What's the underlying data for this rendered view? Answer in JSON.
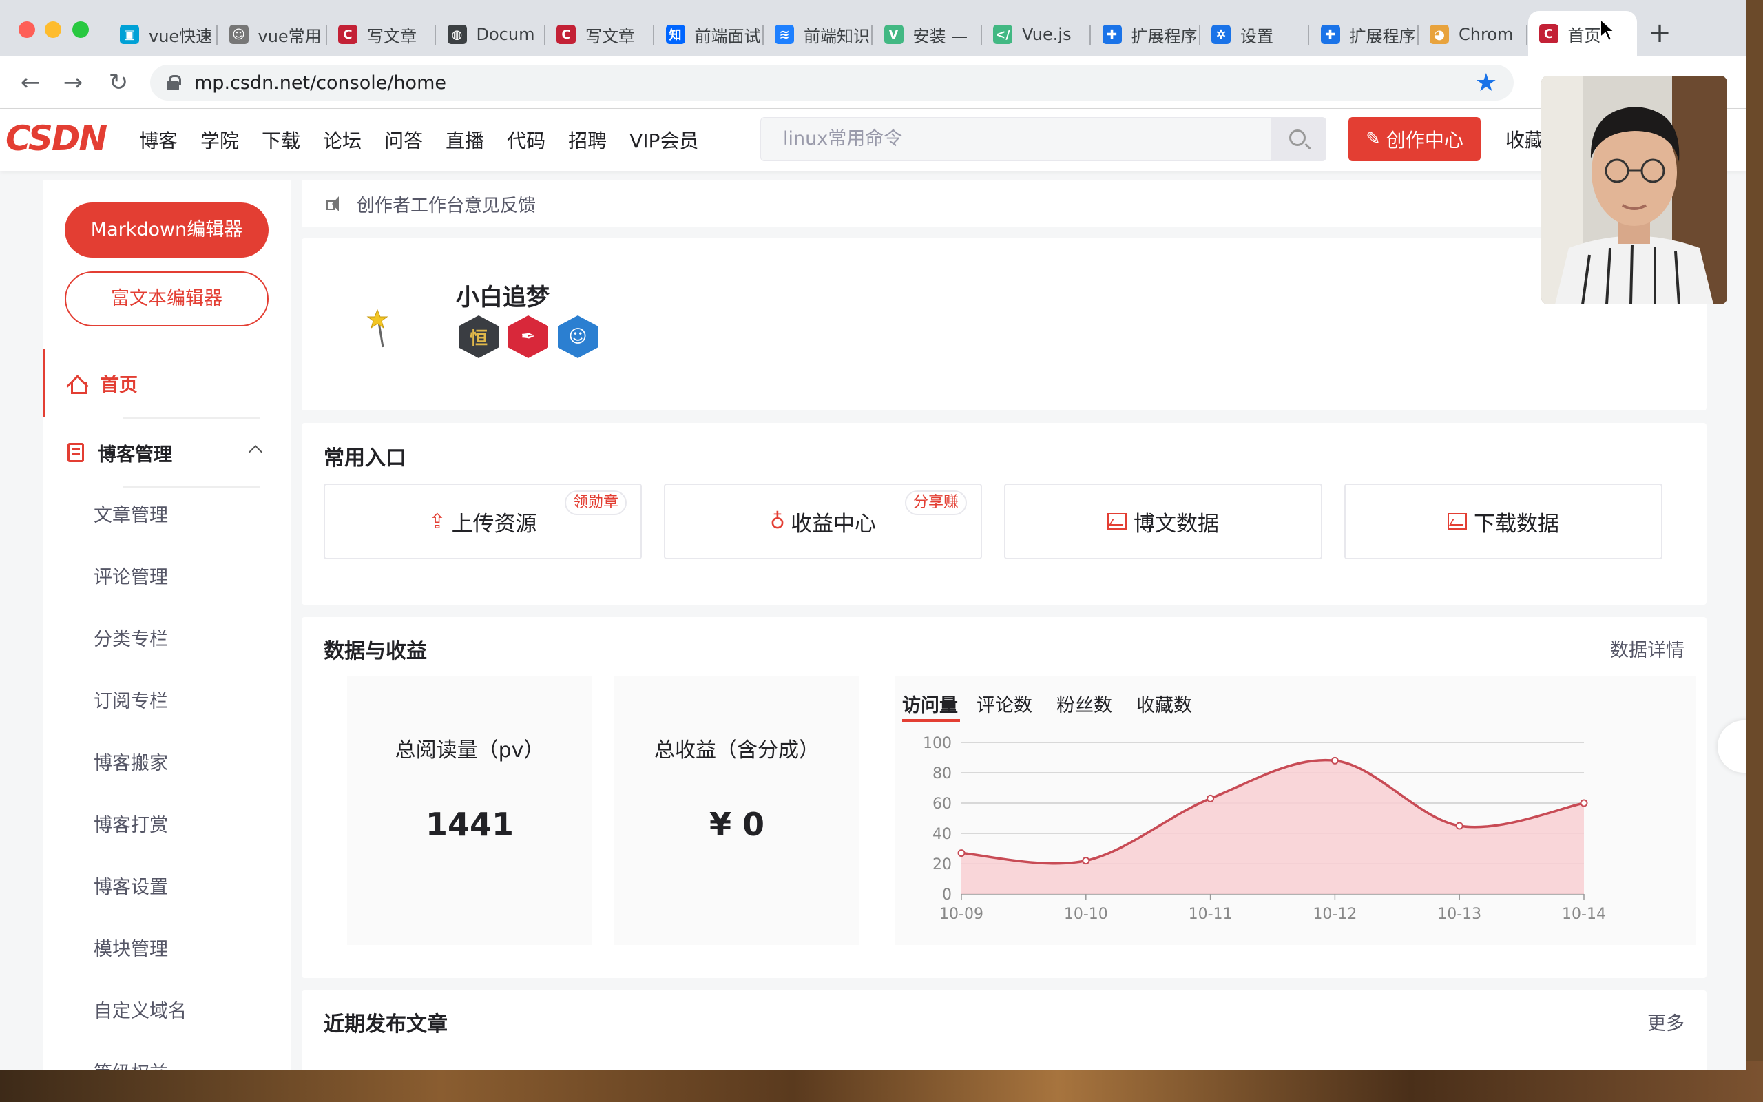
{
  "browser": {
    "tabs": [
      {
        "title": "vue快速",
        "icon": "bilibili-icon",
        "color": "#00a1d6"
      },
      {
        "title": "vue常用",
        "icon": "avatar-icon",
        "color": "#777777"
      },
      {
        "title": "写文章",
        "icon": "csdn-icon",
        "color": "#c32136"
      },
      {
        "title": "Docum",
        "icon": "globe-icon",
        "color": "#3c4043"
      },
      {
        "title": "写文章",
        "icon": "csdn-icon",
        "color": "#c32136"
      },
      {
        "title": "前端面试",
        "icon": "zhihu-icon",
        "color": "#0066ff"
      },
      {
        "title": "前端知识",
        "icon": "juejin-icon",
        "color": "#1e80ff"
      },
      {
        "title": "安装 —",
        "icon": "vue-icon",
        "color": "#42b883"
      },
      {
        "title": "Vue.js",
        "icon": "code-icon",
        "color": "#42b883"
      },
      {
        "title": "扩展程序",
        "icon": "puzzle-icon",
        "color": "#1a73e8"
      },
      {
        "title": "设置",
        "icon": "gear-icon",
        "color": "#1a73e8"
      },
      {
        "title": "扩展程序",
        "icon": "puzzle-icon",
        "color": "#1a73e8"
      },
      {
        "title": "Chrom",
        "icon": "chrome-icon",
        "color": "#e8a33d"
      },
      {
        "title": "首页",
        "icon": "csdn-icon",
        "color": "#c32136",
        "active": true
      }
    ],
    "new_tab": "+",
    "url": "mp.csdn.net/console/home"
  },
  "header": {
    "logo": "CSDN",
    "nav": [
      "博客",
      "学院",
      "下载",
      "论坛",
      "问答",
      "直播",
      "代码",
      "招聘",
      "VIP会员"
    ],
    "search_placeholder": "linux常用命令",
    "create_label": "创作中心",
    "favorites_label": "收藏"
  },
  "sidebar": {
    "markdown_label": "Markdown编辑器",
    "richtext_label": "富文本编辑器",
    "home_label": "首页",
    "blog_manage_label": "博客管理",
    "items": [
      "文章管理",
      "评论管理",
      "分类专栏",
      "订阅专栏",
      "博客搬家",
      "博客打赏",
      "博客设置",
      "模块管理",
      "自定义域名",
      "等级权益"
    ]
  },
  "notice": {
    "text": "创作者工作台意见反馈"
  },
  "profile": {
    "username": "小白追梦",
    "badges": [
      {
        "name": "persistence-badge-icon",
        "glyph": "恒",
        "bg": "#3a3d42",
        "fg": "#e0b84a"
      },
      {
        "name": "pen-badge-icon",
        "glyph": "✒",
        "bg": "#d8283a",
        "fg": "#ffffff"
      },
      {
        "name": "astronaut-badge-icon",
        "glyph": "☺",
        "bg": "#2b7fd1",
        "fg": "#ffffff"
      }
    ]
  },
  "quick_entry": {
    "title": "常用入口",
    "buttons": [
      {
        "label": "上传资源",
        "tag": "领勋章"
      },
      {
        "label": "收益中心",
        "tag": "分享赚"
      },
      {
        "label": "博文数据",
        "tag": ""
      },
      {
        "label": "下载数据",
        "tag": ""
      }
    ]
  },
  "data_income": {
    "title": "数据与收益",
    "detail_label": "数据详情",
    "total_reads_label": "总阅读量（pv）",
    "total_reads_value": "1441",
    "total_income_label": "总收益（含分成）",
    "total_income_value": "¥ 0",
    "chart_tabs": [
      "访问量",
      "评论数",
      "粉丝数",
      "收藏数"
    ],
    "active_tab": "访问量"
  },
  "chart_data": {
    "type": "area",
    "categories": [
      "10-09",
      "10-10",
      "10-11",
      "10-12",
      "10-13",
      "10-14"
    ],
    "values": [
      27,
      22,
      63,
      88,
      45,
      60
    ],
    "ylim": [
      0,
      100
    ],
    "yticks": [
      0,
      20,
      40,
      60,
      80,
      100
    ],
    "grid": true,
    "line_color": "#c84b55",
    "fill_color": "#f8cfd2"
  },
  "recent": {
    "title": "近期发布文章",
    "more_label": "更多"
  },
  "colors": {
    "brand": "#e33e33",
    "page_bg": "#f5f6f7"
  }
}
